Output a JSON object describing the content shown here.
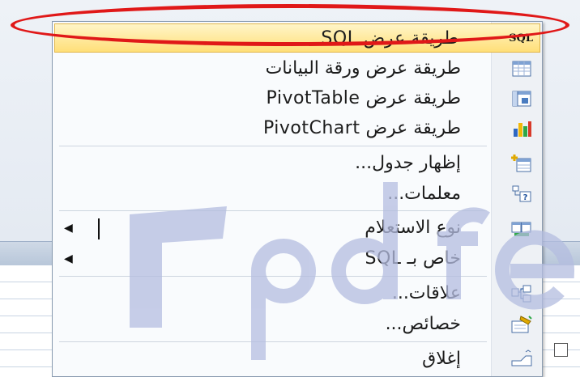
{
  "menu": {
    "items": [
      {
        "key": "sql-view",
        "label": "طريقة عرض SQL",
        "icon": "sql-text-icon",
        "icon_text": "SQL",
        "highlighted": true
      },
      {
        "key": "datasheet-view",
        "label": "طريقة عرض ورقة البيانات",
        "icon": "datasheet-icon"
      },
      {
        "key": "pivottable-view",
        "label": "طريقة عرض PivotTable",
        "icon": "pivottable-icon"
      },
      {
        "key": "pivotchart-view",
        "label": "طريقة عرض PivotChart",
        "icon": "pivotchart-icon"
      },
      {
        "key": "show-table",
        "label": "إظهار جدول...",
        "icon": "show-table-icon"
      },
      {
        "key": "parameters",
        "label": "معلمات...",
        "icon": "parameters-icon"
      },
      {
        "key": "query-type",
        "label": "نوع الاستعلام",
        "icon": "query-type-icon",
        "submenu": true
      },
      {
        "key": "sql-specific",
        "label": "خاص بـ SQL",
        "icon": "none",
        "submenu": true
      },
      {
        "key": "relationships",
        "label": "علاقات...",
        "icon": "relationships-icon"
      },
      {
        "key": "properties",
        "label": "خصائص...",
        "icon": "properties-icon"
      },
      {
        "key": "close",
        "label": "إغلاق",
        "icon": "close-icon"
      }
    ]
  },
  "colors": {
    "highlight_ring": "#e01818",
    "highlight_fill": "#ffdf78",
    "watermark": "#b4bde0"
  }
}
